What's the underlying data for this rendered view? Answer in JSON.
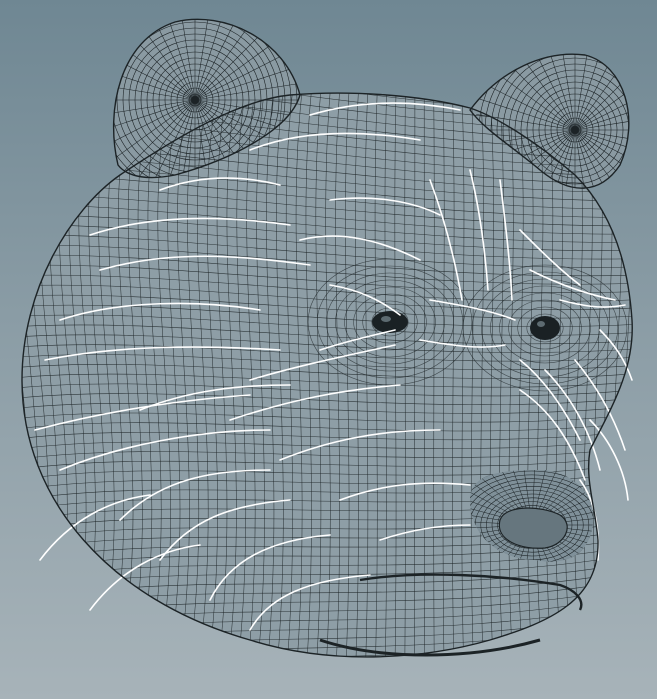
{
  "viewport": {
    "background_top": "#6f8793",
    "background_bottom": "#a7b3b9"
  },
  "model": {
    "subject": "bear-head",
    "render_mode": "wireframe-quad-mesh",
    "mesh_fill": "#8e9ea6",
    "wire_color": "#1c2326",
    "flow_line_color": "#ffffff",
    "features": [
      "left-ear",
      "right-ear",
      "left-eye",
      "right-eye",
      "snout",
      "nose",
      "mouth"
    ]
  }
}
